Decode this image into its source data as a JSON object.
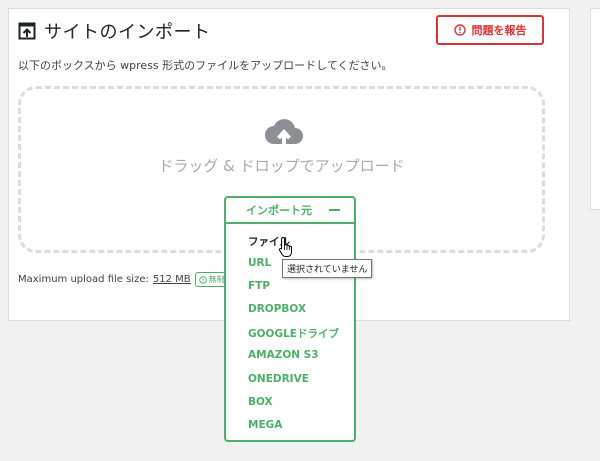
{
  "header": {
    "title": "サイトのインポート",
    "title_icon": "import-upload-icon",
    "report_button_label": "問題を報告",
    "report_icon": "warning-circle-icon"
  },
  "instructions": "以下のボックスから wpress 形式のファイルをアップロードしてください。",
  "dropzone": {
    "text": "ドラッグ & ドロップでアップロード",
    "icon": "cloud-upload-icon"
  },
  "upload_info": {
    "label": "Maximum upload file size:",
    "size": "512 MB",
    "badge": "無制限版の購入"
  },
  "import_menu": {
    "header": "インポート元",
    "collapse_icon": "minus-icon",
    "items": [
      {
        "label": "ファイル",
        "selected": true
      },
      {
        "label": "URL",
        "selected": false
      },
      {
        "label": "FTP",
        "selected": false
      },
      {
        "label": "DROPBOX",
        "selected": false
      },
      {
        "label": "GOOGLEドライブ",
        "selected": false
      },
      {
        "label": "AMAZON S3",
        "selected": false
      },
      {
        "label": "ONEDRIVE",
        "selected": false
      },
      {
        "label": "BOX",
        "selected": false
      },
      {
        "label": "MEGA",
        "selected": false
      }
    ]
  },
  "tooltip": "選択されていません",
  "colors": {
    "accent_green": "#4fae6a",
    "danger_red": "#d63638",
    "dropzone_border": "#dcdcde",
    "background": "#f1f1f1"
  }
}
